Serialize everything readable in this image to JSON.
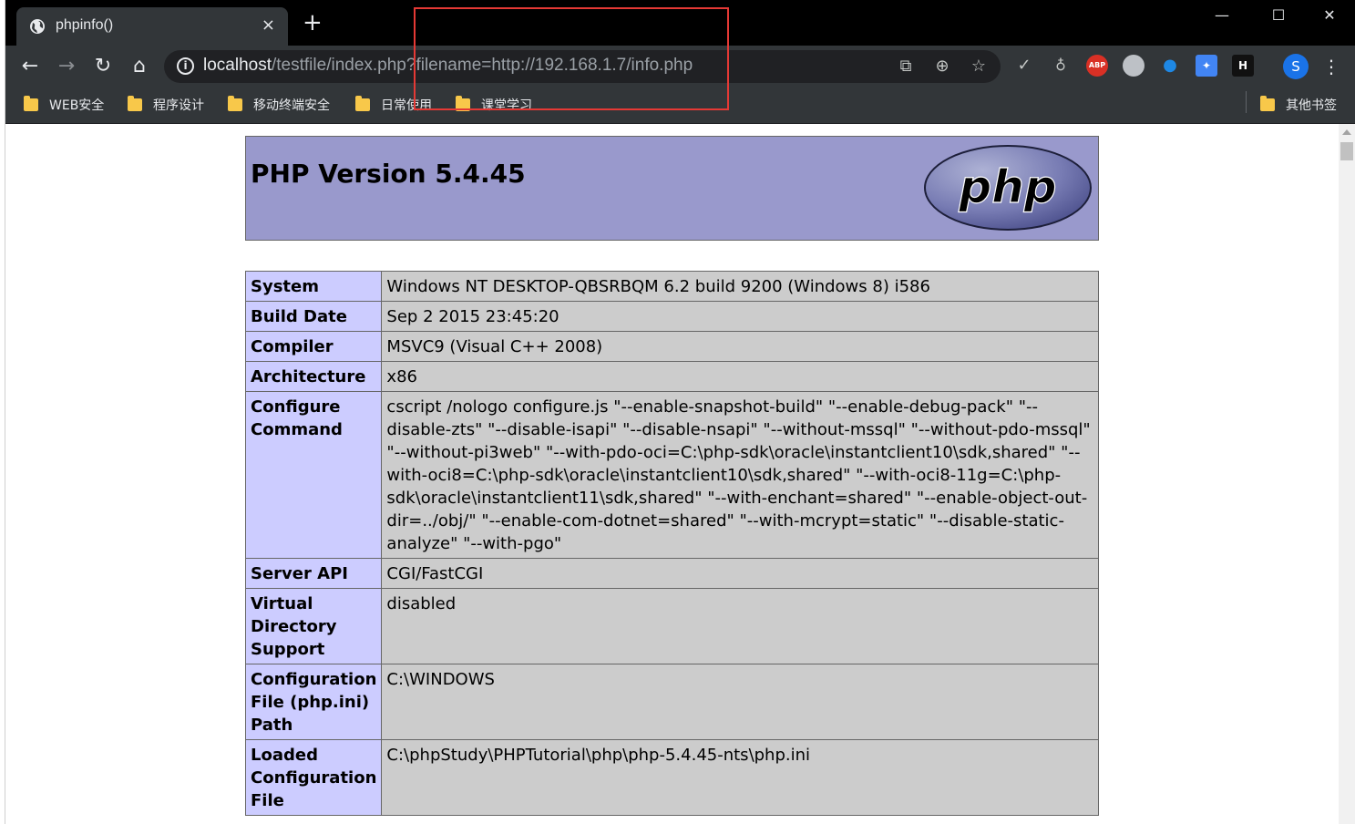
{
  "tab": {
    "title": "phpinfo()",
    "close": "×",
    "new_tab": "+"
  },
  "window_controls": {
    "minimize": "—",
    "maximize": "☐",
    "close": "✕"
  },
  "toolbar": {
    "back": "←",
    "forward": "→",
    "reload": "↻",
    "home": "⌂",
    "url_host": "localhost",
    "url_rest": "/testfile/index.php?filename=http://192.168.1.7/info.php",
    "avatar_letter": "S",
    "abp_label": "ABP"
  },
  "bookmarks": [
    {
      "label": "WEB安全"
    },
    {
      "label": "程序设计"
    },
    {
      "label": "移动终端安全"
    },
    {
      "label": "日常使用"
    },
    {
      "label": "课堂学习"
    }
  ],
  "other_bookmarks": "其他书签",
  "php": {
    "version_title": "PHP Version 5.4.45",
    "logo_text": "php"
  },
  "info_rows": [
    {
      "key": "System",
      "value": "Windows NT DESKTOP-QBSRBQM 6.2 build 9200 (Windows 8) i586"
    },
    {
      "key": "Build Date",
      "value": "Sep 2 2015 23:45:20"
    },
    {
      "key": "Compiler",
      "value": "MSVC9 (Visual C++ 2008)"
    },
    {
      "key": "Architecture",
      "value": "x86"
    },
    {
      "key": "Configure Command",
      "value": "cscript /nologo configure.js \"--enable-snapshot-build\" \"--enable-debug-pack\" \"--disable-zts\" \"--disable-isapi\" \"--disable-nsapi\" \"--without-mssql\" \"--without-pdo-mssql\" \"--without-pi3web\" \"--with-pdo-oci=C:\\php-sdk\\oracle\\instantclient10\\sdk,shared\" \"--with-oci8=C:\\php-sdk\\oracle\\instantclient10\\sdk,shared\" \"--with-oci8-11g=C:\\php-sdk\\oracle\\instantclient11\\sdk,shared\" \"--with-enchant=shared\" \"--enable-object-out-dir=../obj/\" \"--enable-com-dotnet=shared\" \"--with-mcrypt=static\" \"--disable-static-analyze\" \"--with-pgo\""
    },
    {
      "key": "Server API",
      "value": "CGI/FastCGI"
    },
    {
      "key": "Virtual Directory Support",
      "value": "disabled"
    },
    {
      "key": "Configuration File (php.ini) Path",
      "value": "C:\\WINDOWS"
    },
    {
      "key": "Loaded Configuration File",
      "value": "C:\\phpStudy\\PHPTutorial\\php\\php-5.4.45-nts\\php.ini"
    }
  ],
  "colors": {
    "header_bg": "#9999cc",
    "key_bg": "#ccccff",
    "value_bg": "#cccccc",
    "highlight": "#e53935"
  }
}
